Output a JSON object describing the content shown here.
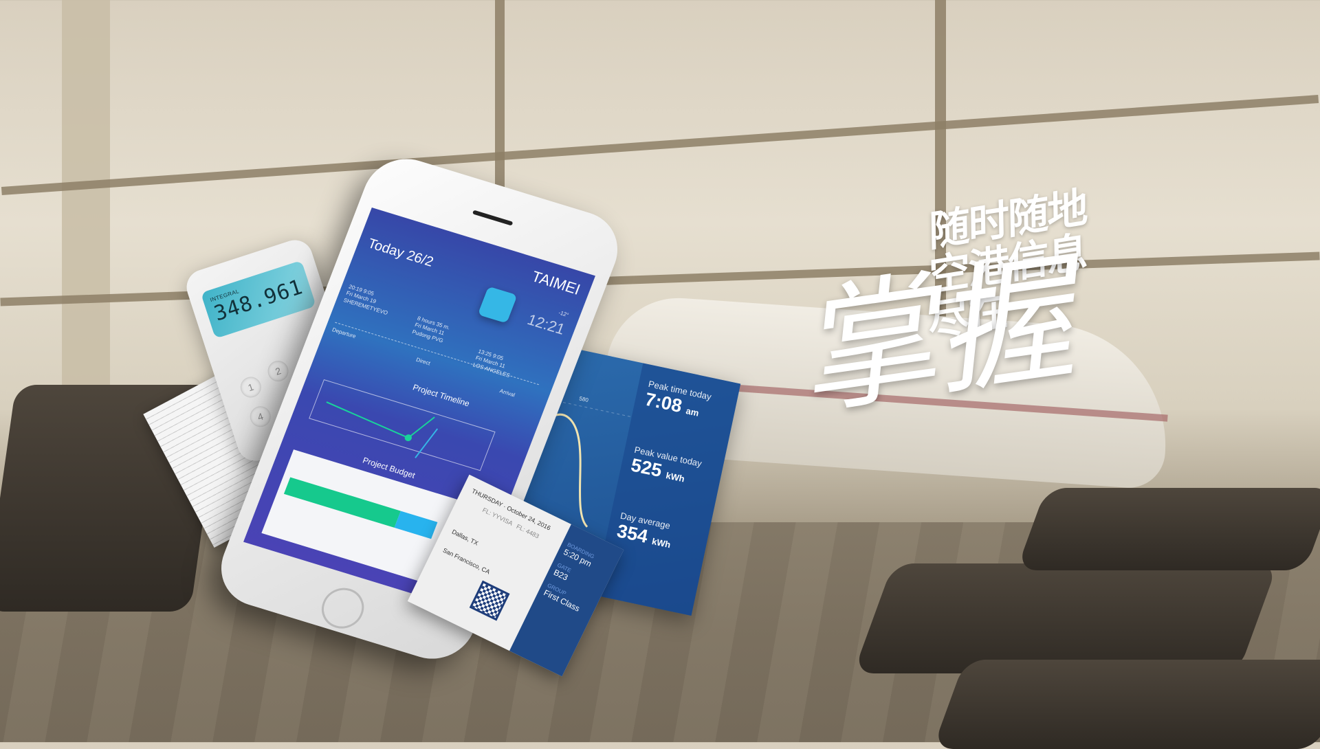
{
  "headline": {
    "line1": "随时随地",
    "line2": "空港信息",
    "line3": "尽在",
    "calligraphy": "掌握"
  },
  "phone": {
    "brand": "TAIMEI",
    "date": "Today  26/2",
    "temp": "-12°",
    "time": "12:21",
    "departure": {
      "time": "20:19 9:05",
      "date": "Fri March 19",
      "place": "SHEREMETYEVO",
      "label": "Departure"
    },
    "duration": {
      "text": "8 hours 35 m.",
      "date": "Fri March 11",
      "place": "Pudong PVG",
      "label": "Direct"
    },
    "arrival": {
      "time": "13:25 9:05",
      "date": "Fri March 11",
      "place": "LOS ANGELES",
      "label": "Arrival"
    },
    "timeline_title": "Project Timeline",
    "budget_title": "Project Budget",
    "budget_fraction": {
      "green": 0.6,
      "blue": 0.2
    }
  },
  "calculator": {
    "label": "INTEGRAL",
    "value": "348.961",
    "keys": [
      "1",
      "2",
      "4"
    ]
  },
  "stats": {
    "axis_label": "580",
    "items": [
      {
        "label": "Peak time today",
        "value": "7:08",
        "unit": "am"
      },
      {
        "label": "Peak value today",
        "value": "525",
        "unit": "kWh"
      },
      {
        "label": "Day average",
        "value": "354",
        "unit": "kWh"
      }
    ]
  },
  "boarding_pass": {
    "day": "THURSDAY",
    "date": "October 24, 2016",
    "flight_code": "FL: YYVISA",
    "flight_no": "FL: 4483",
    "from": "Dallas, TX",
    "to": "San Francisco, CA",
    "boarding_label": "BOARDING",
    "boarding_time": "5:20 pm",
    "gate_label": "GATE",
    "gate": "B23",
    "group_label": "GROUP",
    "group": "First Class"
  }
}
